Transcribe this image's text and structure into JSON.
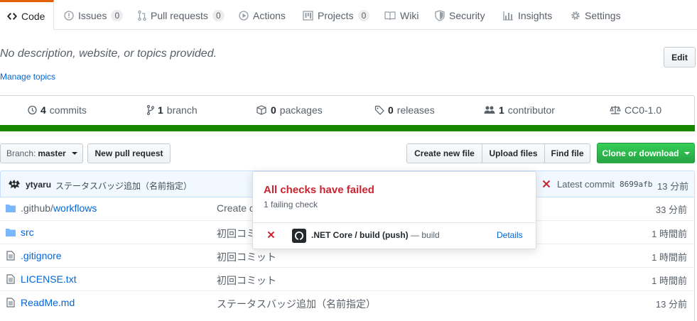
{
  "tabs": [
    {
      "label": "Code",
      "icon": "code-icon",
      "counter": null,
      "selected": true
    },
    {
      "label": "Issues",
      "icon": "issue-opened-icon",
      "counter": "0"
    },
    {
      "label": "Pull requests",
      "icon": "git-pull-request-icon",
      "counter": "0"
    },
    {
      "label": "Actions",
      "icon": "play-icon"
    },
    {
      "label": "Projects",
      "icon": "project-icon",
      "counter": "0"
    },
    {
      "label": "Wiki",
      "icon": "book-icon"
    },
    {
      "label": "Security",
      "icon": "shield-icon"
    },
    {
      "label": "Insights",
      "icon": "graph-icon"
    },
    {
      "label": "Settings",
      "icon": "gear-icon"
    }
  ],
  "description": {
    "text": "No description, website, or topics provided.",
    "manage_topics": "Manage topics",
    "edit_label": "Edit"
  },
  "summary": {
    "commits": {
      "count": "4",
      "label": "commits"
    },
    "branch": {
      "count": "1",
      "label": "branch"
    },
    "packages": {
      "count": "0",
      "label": "packages"
    },
    "releases": {
      "count": "0",
      "label": "releases"
    },
    "contributors": {
      "count": "1",
      "label": "contributor"
    },
    "license": "CC0-1.0",
    "language_color": "#178600"
  },
  "toolbar": {
    "branch_prefix": "Branch:",
    "branch_name": "master",
    "new_pr": "New pull request",
    "create_file": "Create new file",
    "upload_files": "Upload files",
    "find_file": "Find file",
    "clone": "Clone or download"
  },
  "commit": {
    "author": "ytyaru",
    "message": "ステータスバッジ追加（名前指定）",
    "latest_label": "Latest commit",
    "sha": "8699afb",
    "age": "13 分前"
  },
  "files": [
    {
      "type": "dir",
      "prefix": ".github/",
      "name": "workflows",
      "message": "Create c",
      "age": "33 分前"
    },
    {
      "type": "dir",
      "prefix": "",
      "name": "src",
      "message": "初回コミ",
      "age": "1 時間前"
    },
    {
      "type": "file",
      "prefix": "",
      "name": ".gitignore",
      "message": "初回コミット",
      "age": "1 時間前"
    },
    {
      "type": "file",
      "prefix": "",
      "name": "LICENSE.txt",
      "message": "初回コミット",
      "age": "1 時間前"
    },
    {
      "type": "file",
      "prefix": "",
      "name": "ReadMe.md",
      "message": "ステータスバッジ追加（名前指定）",
      "age": "13 分前"
    }
  ],
  "popover": {
    "title": "All checks have failed",
    "subtitle": "1 failing check",
    "check_name": ".NET Core / build (push)",
    "check_suffix": "— build",
    "details": "Details"
  },
  "colors": {
    "link": "#0366d6",
    "failure": "#cb2431",
    "success": "#28a745",
    "tab_accent": "#e36209"
  }
}
